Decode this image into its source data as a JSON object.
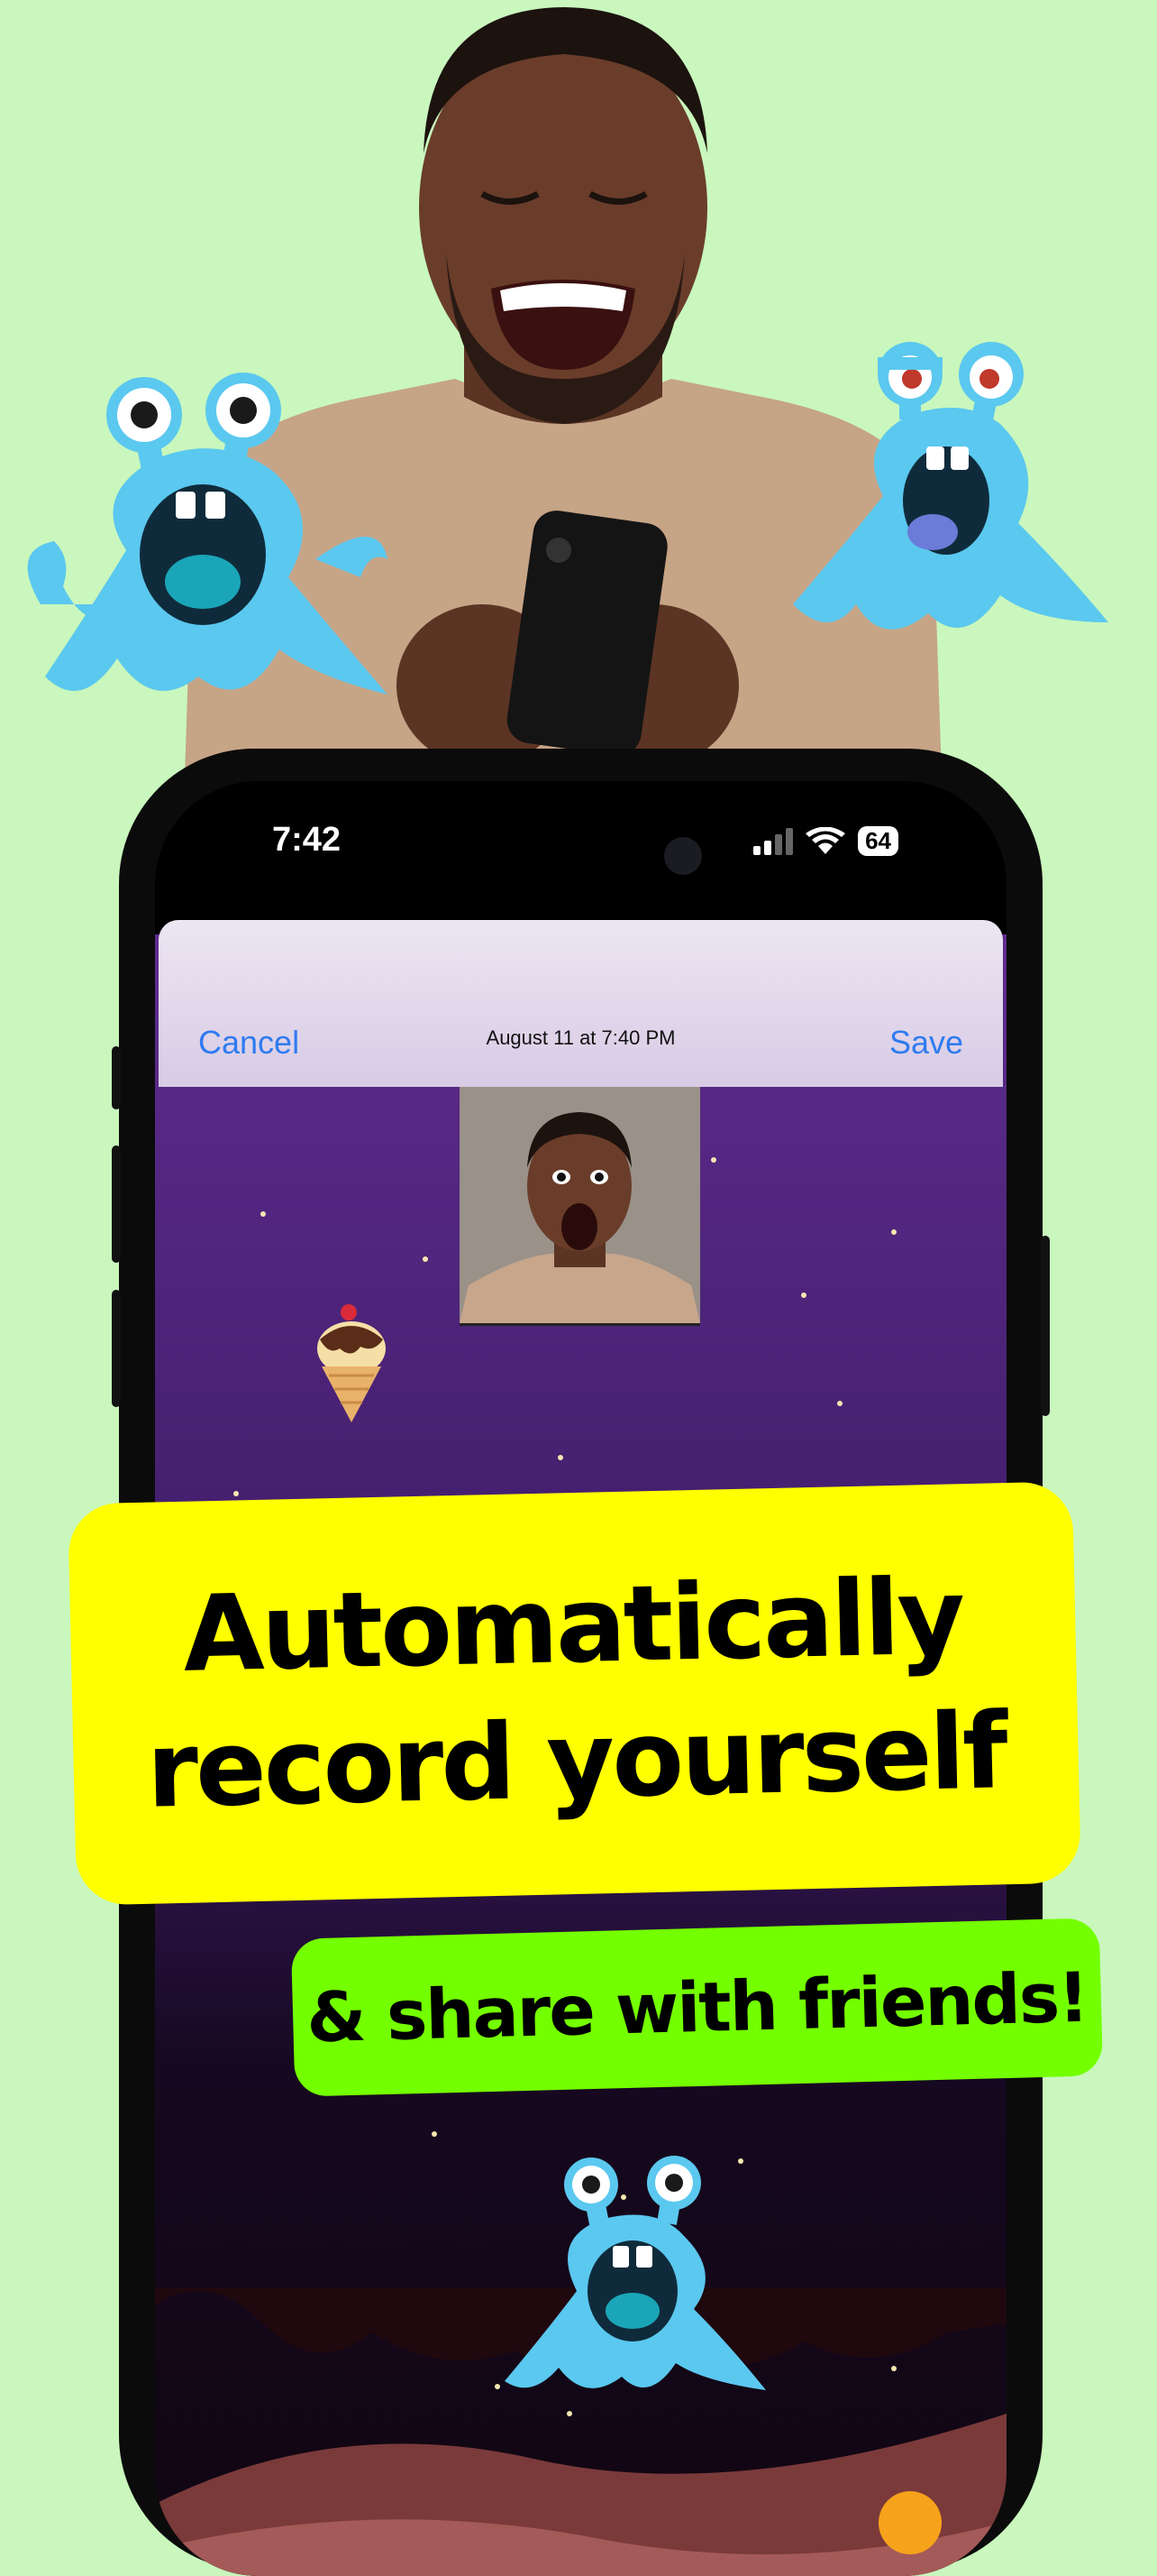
{
  "status_bar": {
    "time": "7:42",
    "battery": "64"
  },
  "modal": {
    "cancel_label": "Cancel",
    "date_label": "August 11 at 7:40 PM",
    "save_label": "Save"
  },
  "headline": {
    "line1": "Automatically",
    "line2": "record yourself"
  },
  "subheadline": "& share with friends!",
  "icons": [
    "alien-icon",
    "ice-cream-icon",
    "signal-icon",
    "wifi-icon",
    "battery-icon"
  ],
  "colors": {
    "background": "#c9f7bd",
    "headline_bg": "#ffff00",
    "subheadline_bg": "#74ff00",
    "link_blue": "#2f7bf0",
    "alien": "#5bc8ef"
  }
}
